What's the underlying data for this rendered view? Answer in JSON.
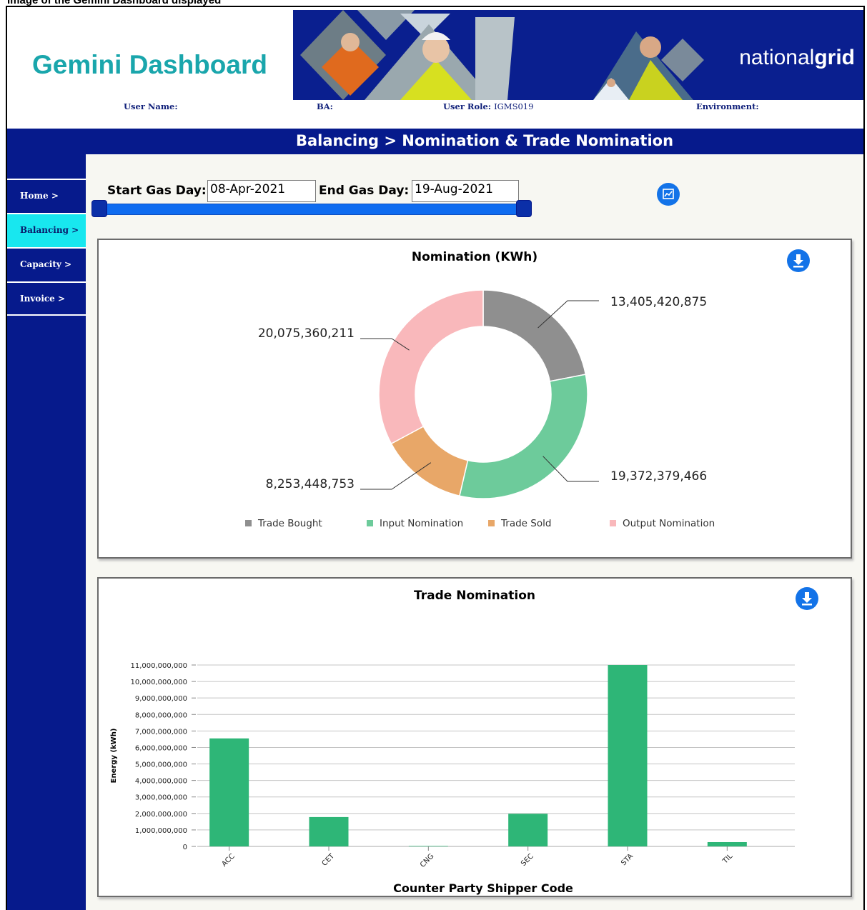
{
  "doc_caption": "Image of the Gemini Dashboard displayed",
  "header": {
    "app_title": "Gemini Dashboard",
    "brand_light": "national",
    "brand_bold": "grid",
    "user_name_label": "User Name:",
    "ba_label": "BA:",
    "user_role_label": "User Role:",
    "user_role_value": "IGMS019",
    "environment_label": "Environment:"
  },
  "page_heading": "Balancing > Nomination & Trade Nomination",
  "sidebar": {
    "items": [
      {
        "label": "Home >",
        "active": false
      },
      {
        "label": "Balancing >",
        "active": true
      },
      {
        "label": "Capacity >",
        "active": false
      },
      {
        "label": "Invoice >",
        "active": false
      }
    ]
  },
  "filters": {
    "start_label": "Start Gas Day:",
    "start_value": "08-Apr-2021",
    "end_label": "End Gas Day:",
    "end_value": "19-Aug-2021",
    "range_fraction": [
      0,
      1
    ],
    "chart_icon": "line-chart-icon"
  },
  "colors": {
    "navy": "#061a8c",
    "teal_title": "#1aa6ac",
    "active_nav": "#18e7ef",
    "button_blue": "#1373e8",
    "trade_bought": "#8f8f8f",
    "input_nomination": "#6dcb9b",
    "trade_sold": "#e8a768",
    "output_nomination": "#f9b8bb",
    "bar": "#2eb677"
  },
  "chart_data": [
    {
      "type": "pie",
      "title": "Nomination (KWh)",
      "slices": [
        {
          "name": "Trade Bought",
          "value": 13405420875,
          "label": "13,405,420,875"
        },
        {
          "name": "Input Nomination",
          "value": 19372379466,
          "label": "19,372,379,466"
        },
        {
          "name": "Trade Sold",
          "value": 8253448753,
          "label": "8,253,448,753"
        },
        {
          "name": "Output Nomination",
          "value": 20075360211,
          "label": "20,075,360,211"
        }
      ],
      "legend_position": "bottom",
      "download_icon": "download-icon"
    },
    {
      "type": "bar",
      "title": "Trade Nomination",
      "categories": [
        "ACC",
        "CET",
        "CNG",
        "SEC",
        "STA",
        "TIL"
      ],
      "values": [
        6550000000,
        1780000000,
        30000000,
        1980000000,
        11000000000,
        260000000
      ],
      "xlabel": "Counter Party Shipper Code",
      "ylabel": "Energy (kWh)",
      "ylim": [
        0,
        11000000000
      ],
      "yticks": [
        "0",
        "1,000,000,000",
        "2,000,000,000",
        "3,000,000,000",
        "4,000,000,000",
        "5,000,000,000",
        "6,000,000,000",
        "7,000,000,000",
        "8,000,000,000",
        "9,000,000,000",
        "10,000,000,000",
        "11,000,000,000"
      ],
      "grid": true,
      "download_icon": "download-icon"
    }
  ]
}
